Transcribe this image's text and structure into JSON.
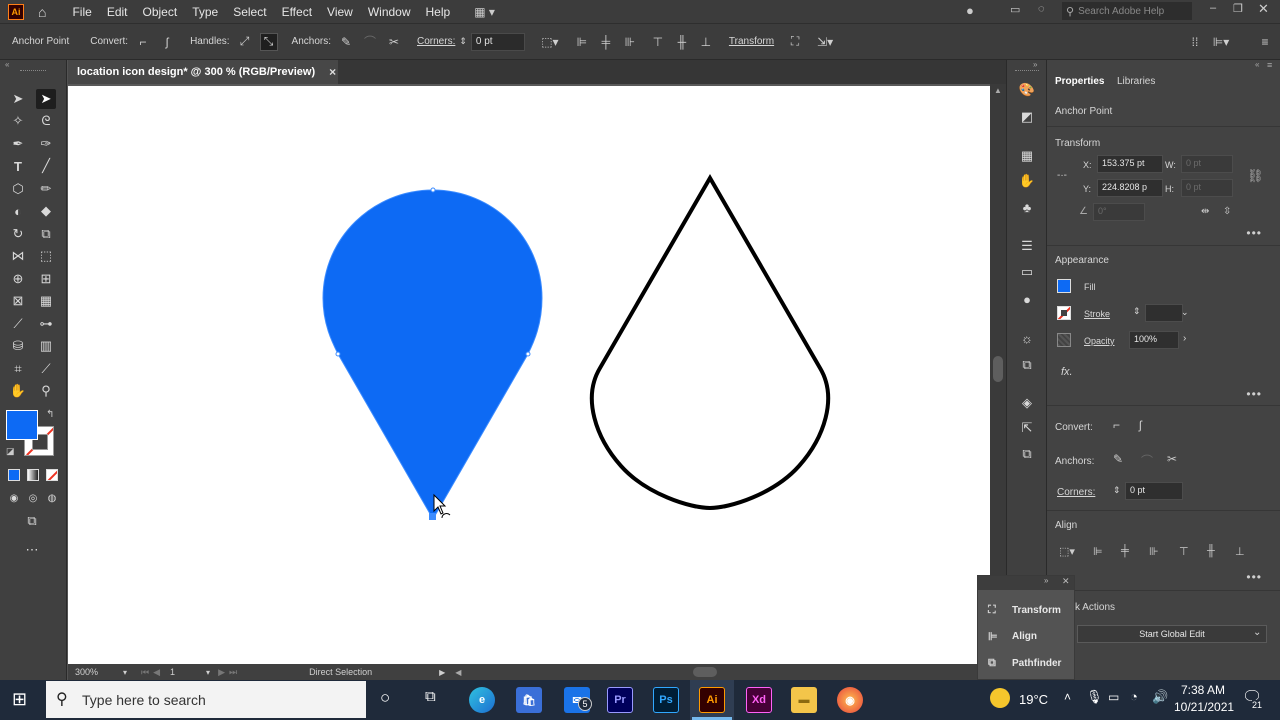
{
  "app": {
    "logo": "Ai"
  },
  "menu": [
    "File",
    "Edit",
    "Object",
    "Type",
    "Select",
    "Effect",
    "View",
    "Window",
    "Help"
  ],
  "search": {
    "placeholder": "Search Adobe Help"
  },
  "controlbar": {
    "anchor_point": "Anchor Point",
    "convert": "Convert:",
    "handles": "Handles:",
    "anchors": "Anchors:",
    "corners": "Corners:",
    "corners_value": "0 pt",
    "transform": "Transform"
  },
  "document": {
    "tab_title": "location icon design* @ 300 % (RGB/Preview)",
    "close": "×"
  },
  "statusbar": {
    "zoom": "300%",
    "artboard": "1",
    "tool": "Direct Selection"
  },
  "properties": {
    "tabs": [
      "Properties",
      "Libraries"
    ],
    "selection": "Anchor Point",
    "transform": {
      "title": "Transform",
      "x_label": "X:",
      "x_value": "153.375 pt",
      "y_label": "Y:",
      "y_value": "224.8208 p",
      "w_label": "W:",
      "w_value": "0 pt",
      "h_label": "H:",
      "h_value": "0 pt",
      "angle_value": "0°"
    },
    "appearance": {
      "title": "Appearance",
      "fill": "Fill",
      "stroke": "Stroke",
      "opacity": "Opacity",
      "opacity_value": "100%",
      "fx": "fx."
    },
    "convert": "Convert:",
    "anchors": "Anchors:",
    "corners": "Corners:",
    "corners_value": "0 pt",
    "align": {
      "title": "Align"
    },
    "quick_actions": {
      "title": "k Actions",
      "button": "Start Global Edit"
    }
  },
  "floating_panel": {
    "items": [
      "Transform",
      "Align",
      "Pathfinder"
    ]
  },
  "taskbar": {
    "search_placeholder": "Type here to search",
    "weather": "19°C",
    "time": "7:38 AM",
    "date": "10/21/2021",
    "mail_badge": "5",
    "notification_count": "21",
    "apps": [
      "Pr",
      "Ps",
      "Ai",
      "Xd"
    ]
  },
  "colors": {
    "fill_blue": "#0d6af4",
    "accent": "#ff9a00"
  }
}
